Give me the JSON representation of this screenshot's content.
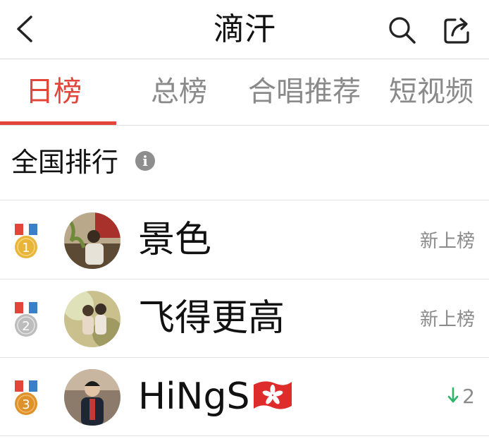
{
  "header": {
    "title": "滴汗",
    "back_icon": "chevron-left-icon",
    "search_icon": "search-icon",
    "share_icon": "share-icon"
  },
  "tabs": [
    {
      "label": "日榜",
      "active": true
    },
    {
      "label": "总榜",
      "active": false
    },
    {
      "label": "合唱推荐",
      "active": false
    },
    {
      "label": "短视频",
      "active": false
    }
  ],
  "section": {
    "title": "全国排行",
    "info_glyph": "i"
  },
  "rankings": [
    {
      "rank": "1",
      "name": "景色",
      "status": "新上榜",
      "medal_color": "#e8b43a"
    },
    {
      "rank": "2",
      "name": "飞得更高",
      "status": "新上榜",
      "medal_color": "#bdbdbd"
    },
    {
      "rank": "3",
      "name": "HiNgS",
      "change": "2",
      "change_direction": "down",
      "medal_color": "#e0922a"
    }
  ],
  "colors": {
    "accent": "#e2463b",
    "muted_text": "#8a8a8a",
    "down_arrow": "#2fb36b",
    "ribbon_red": "#e2463b",
    "ribbon_blue": "#3b7fc4"
  }
}
